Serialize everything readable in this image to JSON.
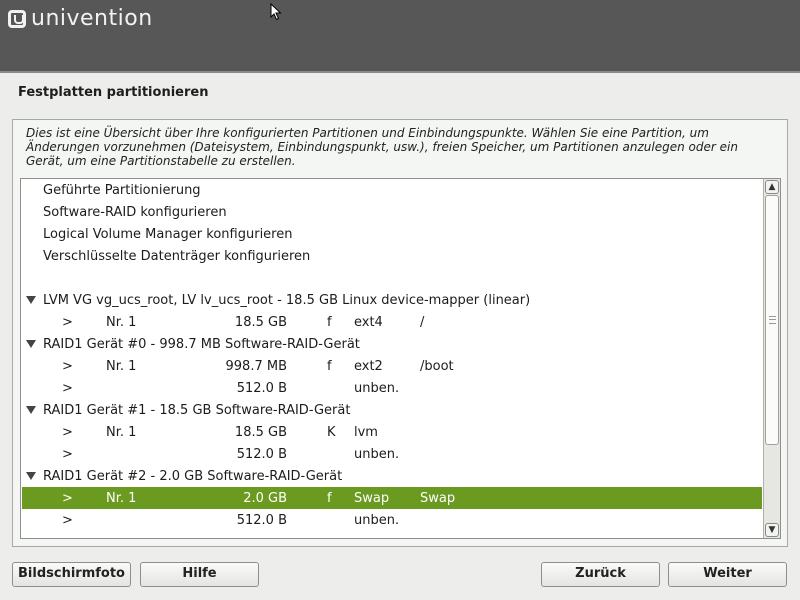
{
  "brand": {
    "name": "univention"
  },
  "page": {
    "title": "Festplatten partitionieren"
  },
  "description": "Dies ist eine Übersicht über Ihre konfigurierten Partitionen und Einbindungspunkte. Wählen Sie eine Partition, um Änderungen vorzunehmen (Dateisystem, Einbindungspunkt, usw.), freien Speicher, um Partitionen anzulegen oder ein Gerät, um eine Partitionstabelle zu erstellen.",
  "list": {
    "actions": [
      "Geführte Partitionierung",
      "Software-RAID konfigurieren",
      "Logical Volume Manager konfigurieren",
      "Verschlüsselte Datenträger konfigurieren"
    ],
    "devices": [
      {
        "label": "LVM VG vg_ucs_root, LV lv_ucs_root - 18.5 GB Linux device-mapper (linear)",
        "partitions": [
          {
            "arrow": ">",
            "nr": "Nr. 1",
            "size": "18.5 GB",
            "flag": "f",
            "fs": "ext4",
            "mount": "/"
          }
        ]
      },
      {
        "label": "RAID1 Gerät #0 - 998.7 MB Software-RAID-Gerät",
        "partitions": [
          {
            "arrow": ">",
            "nr": "Nr. 1",
            "size": "998.7 MB",
            "flag": "f",
            "fs": "ext2",
            "mount": "/boot"
          },
          {
            "arrow": ">",
            "nr": "",
            "size": "512.0 B",
            "flag": "",
            "fs": "unben.",
            "mount": ""
          }
        ]
      },
      {
        "label": "RAID1 Gerät #1 - 18.5 GB Software-RAID-Gerät",
        "partitions": [
          {
            "arrow": ">",
            "nr": "Nr. 1",
            "size": "18.5 GB",
            "flag": "K",
            "fs": "lvm",
            "mount": ""
          },
          {
            "arrow": ">",
            "nr": "",
            "size": "512.0 B",
            "flag": "",
            "fs": "unben.",
            "mount": ""
          }
        ]
      },
      {
        "label": "RAID1 Gerät #2 - 2.0 GB Software-RAID-Gerät",
        "partitions": [
          {
            "arrow": ">",
            "nr": "Nr. 1",
            "size": "2.0 GB",
            "flag": "f",
            "fs": "Swap",
            "mount": "Swap",
            "selected": true
          },
          {
            "arrow": ">",
            "nr": "",
            "size": "512.0 B",
            "flag": "",
            "fs": "unben.",
            "mount": ""
          }
        ]
      }
    ]
  },
  "buttons": {
    "screenshot": "Bildschirmfoto",
    "help": "Hilfe",
    "back": "Zurück",
    "next": "Weiter"
  },
  "colors": {
    "selection": "#6a9b20",
    "topbar": "#575757"
  }
}
